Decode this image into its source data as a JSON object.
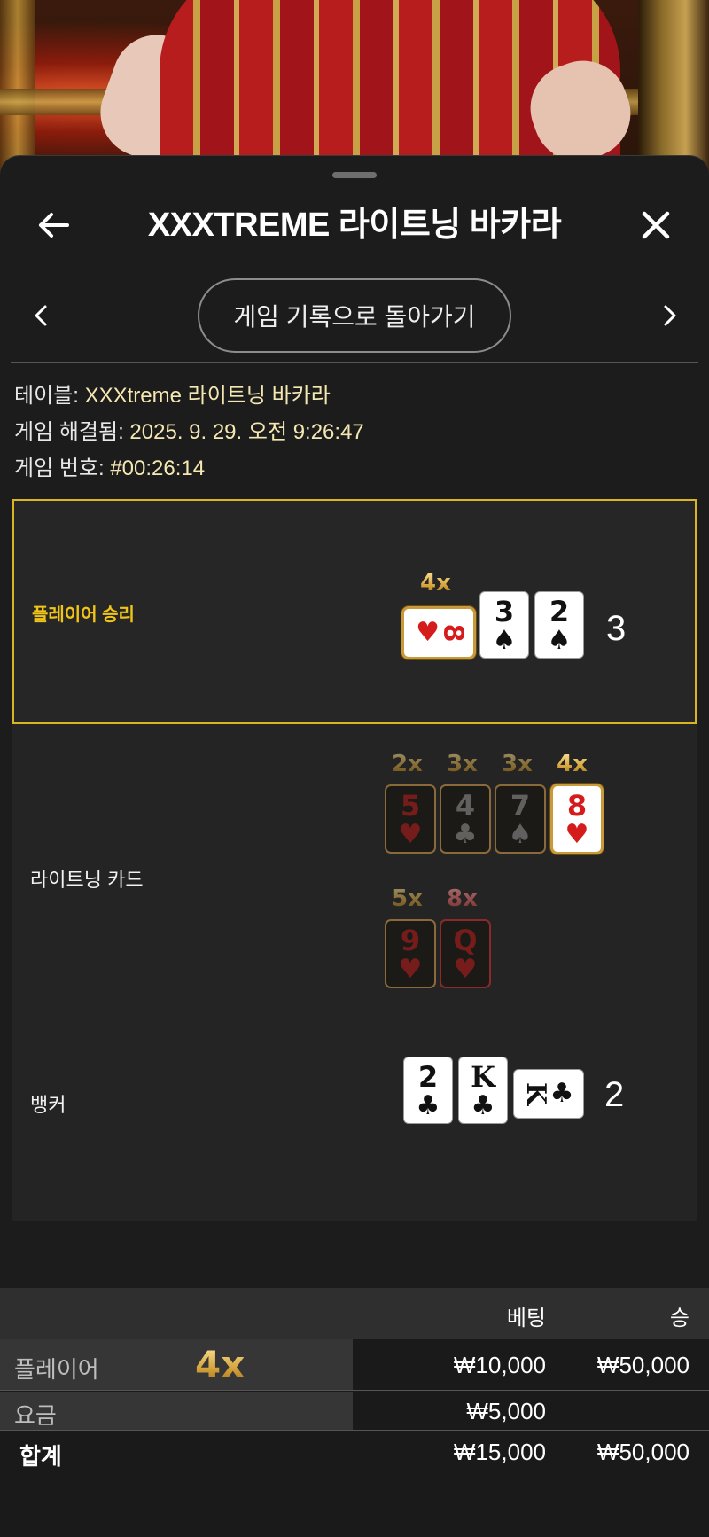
{
  "header": {
    "title": "XXXTREME 라이트닝 바카라"
  },
  "nav": {
    "history_label": "게임 기록으로 돌아가기"
  },
  "info": {
    "table_label": "테이블:",
    "table_value": "XXXtreme 라이트닝 바카라",
    "resolved_label": "게임 해결됨:",
    "resolved_value": "2025. 9. 29. 오전 9:26:47",
    "number_label": "게임 번호:",
    "number_value": "#00:26:14"
  },
  "rounds": {
    "player": {
      "label": "플레이어 승리",
      "multiplier": "4x",
      "cards": [
        {
          "rank": "8",
          "suit": "♥",
          "color": "red",
          "orientation": "side",
          "multiplier": "4x"
        },
        {
          "rank": "3",
          "suit": "♠",
          "color": "black"
        },
        {
          "rank": "2",
          "suit": "♠",
          "color": "black"
        }
      ],
      "score": "3"
    },
    "lightning": {
      "label": "라이트닝 카드",
      "cards": [
        {
          "rank": "5",
          "suit": "♥",
          "multiplier": "2x",
          "color": "red",
          "state": "dim"
        },
        {
          "rank": "4",
          "suit": "♣",
          "multiplier": "3x",
          "color": "black",
          "state": "dim"
        },
        {
          "rank": "7",
          "suit": "♠",
          "multiplier": "3x",
          "color": "black",
          "state": "dim"
        },
        {
          "rank": "8",
          "suit": "♥",
          "multiplier": "4x",
          "color": "red",
          "state": "active"
        },
        {
          "rank": "9",
          "suit": "♥",
          "multiplier": "5x",
          "color": "red",
          "state": "dim"
        },
        {
          "rank": "Q",
          "suit": "♥",
          "multiplier": "8x",
          "color": "red",
          "state": "dim"
        }
      ]
    },
    "banker": {
      "label": "뱅커",
      "cards": [
        {
          "rank": "2",
          "suit": "♣",
          "color": "black"
        },
        {
          "rank": "K",
          "suit": "♣",
          "color": "black"
        },
        {
          "rank": "K",
          "suit": "♣",
          "color": "black",
          "orientation": "side"
        }
      ],
      "score": "2"
    }
  },
  "bets": {
    "col_bet": "베팅",
    "col_win": "승",
    "rows": [
      {
        "name": "플레이어",
        "multiplier": "4x",
        "bet": "₩10,000",
        "win": "₩50,000"
      },
      {
        "name": "요금",
        "bet": "₩5,000",
        "win": ""
      }
    ],
    "total": {
      "name": "합계",
      "bet": "₩15,000",
      "win": "₩50,000"
    }
  },
  "colors": {
    "accent": "#f0c419",
    "info_value": "#f4e7b2",
    "panel_border": "#d9b522"
  },
  "icons": {
    "back": "arrow-left-icon",
    "close": "close-icon",
    "prev": "chevron-left-icon",
    "next": "chevron-right-icon"
  }
}
